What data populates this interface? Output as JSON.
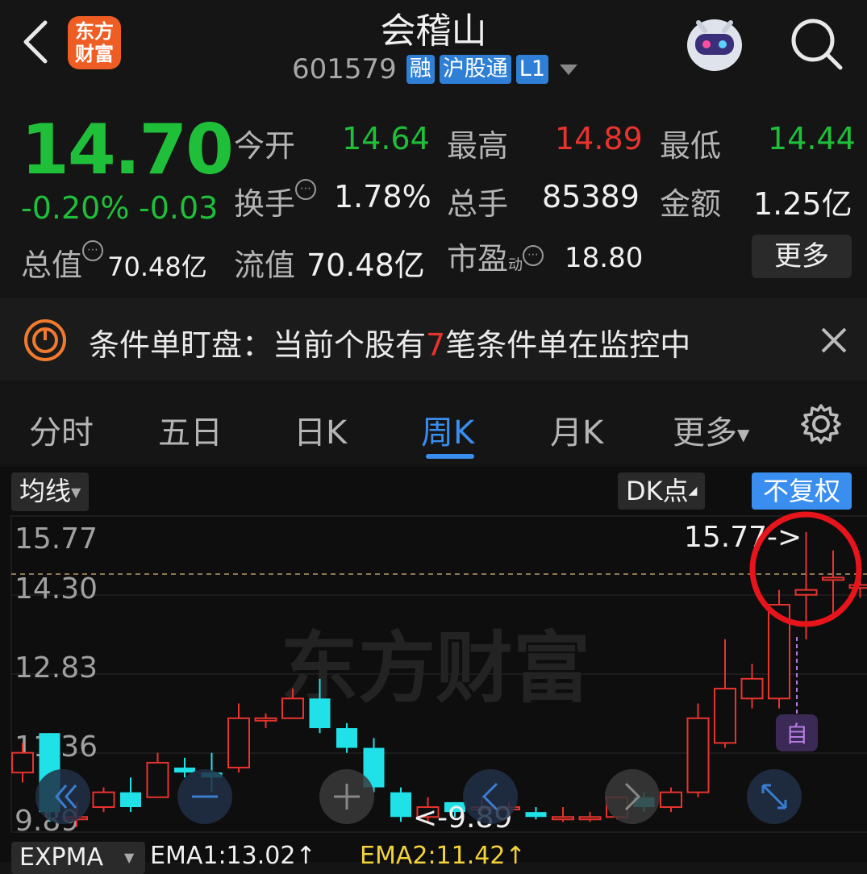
{
  "header": {
    "back_label": "back",
    "logo_line1": "东方",
    "logo_line2": "财富",
    "title": "会稽山",
    "stock_code": "601579",
    "tags": [
      "融",
      "沪股通",
      "L1"
    ]
  },
  "quote": {
    "price": "14.70",
    "change_pct": "-0.20%",
    "change_abs": "-0.03",
    "total_value_label": "总值",
    "total_value": "70.48亿",
    "open_label": "今开",
    "open": "14.64",
    "high_label": "最高",
    "high": "14.89",
    "low_label": "最低",
    "low": "14.44",
    "turnover_label": "换手",
    "turnover": "1.78%",
    "volume_label": "总手",
    "volume": "85389",
    "amount_label": "金额",
    "amount": "1.25亿",
    "float_value_label": "流值",
    "float_value": "70.48亿",
    "pe_label": "市盈",
    "pe_sup": "动",
    "pe": "18.80",
    "more_label": "更多"
  },
  "notice": {
    "prefix": "条件单盯盘：当前个股有",
    "count": "7",
    "suffix": "笔条件单在监控中"
  },
  "tabs": [
    {
      "label": "分时",
      "active": false
    },
    {
      "label": "五日",
      "active": false
    },
    {
      "label": "日K",
      "active": false
    },
    {
      "label": "周K",
      "active": true
    },
    {
      "label": "月K",
      "active": false
    },
    {
      "label": "更多",
      "active": false
    }
  ],
  "chart_toolbar": {
    "ma_label": "均线",
    "dk_label": "DK点",
    "adjust_label": "不复权"
  },
  "chart_data": {
    "type": "candlestick",
    "y_ticks": [
      "15.77",
      "14.30",
      "12.83",
      "11.36",
      "9.89"
    ],
    "ylim": [
      9.89,
      15.77
    ],
    "max_marker": "15.77->",
    "min_marker": "<-9.89",
    "watermark": "东方财富",
    "self_select_badge": "自",
    "candles": [
      {
        "o": 10.9,
        "c": 11.3,
        "h": 11.5,
        "l": 10.7
      },
      {
        "o": 11.7,
        "c": 10.1,
        "h": 11.7,
        "l": 9.9
      },
      {
        "o": 10.0,
        "c": 10.0,
        "h": 10.3,
        "l": 9.8
      },
      {
        "o": 10.2,
        "c": 10.5,
        "h": 10.6,
        "l": 10.1
      },
      {
        "o": 10.5,
        "c": 10.2,
        "h": 10.8,
        "l": 10.1
      },
      {
        "o": 10.4,
        "c": 11.1,
        "h": 11.3,
        "l": 10.4
      },
      {
        "o": 11.0,
        "c": 10.9,
        "h": 11.2,
        "l": 10.8
      },
      {
        "o": 10.9,
        "c": 10.8,
        "h": 11.3,
        "l": 10.5
      },
      {
        "o": 11.0,
        "c": 12.0,
        "h": 12.3,
        "l": 10.9
      },
      {
        "o": 12.0,
        "c": 12.0,
        "h": 12.1,
        "l": 11.8
      },
      {
        "o": 12.0,
        "c": 12.4,
        "h": 12.6,
        "l": 12.0
      },
      {
        "o": 12.4,
        "c": 11.8,
        "h": 12.8,
        "l": 11.7
      },
      {
        "o": 11.8,
        "c": 11.4,
        "h": 11.9,
        "l": 11.3
      },
      {
        "o": 11.4,
        "c": 10.6,
        "h": 11.6,
        "l": 10.5
      },
      {
        "o": 10.5,
        "c": 10.0,
        "h": 10.6,
        "l": 9.9
      },
      {
        "o": 10.0,
        "c": 10.2,
        "h": 10.4,
        "l": 9.89
      },
      {
        "o": 10.3,
        "c": 10.1,
        "h": 10.3,
        "l": 10.0
      },
      {
        "o": 10.2,
        "c": 10.2,
        "h": 10.4,
        "l": 10.1
      },
      {
        "o": 10.2,
        "c": 10.2,
        "h": 10.3,
        "l": 10.1
      },
      {
        "o": 10.1,
        "c": 10.0,
        "h": 10.2,
        "l": 9.95
      },
      {
        "o": 10.0,
        "c": 10.0,
        "h": 10.2,
        "l": 9.9
      },
      {
        "o": 10.0,
        "c": 10.0,
        "h": 10.1,
        "l": 9.9
      },
      {
        "o": 10.0,
        "c": 10.4,
        "h": 10.4,
        "l": 9.95
      },
      {
        "o": 10.4,
        "c": 10.2,
        "h": 10.5,
        "l": 10.1
      },
      {
        "o": 10.2,
        "c": 10.5,
        "h": 10.6,
        "l": 10.1
      },
      {
        "o": 10.5,
        "c": 12.0,
        "h": 12.3,
        "l": 10.4
      },
      {
        "o": 11.5,
        "c": 12.6,
        "h": 13.6,
        "l": 11.4
      },
      {
        "o": 12.4,
        "c": 12.8,
        "h": 13.1,
        "l": 12.2
      },
      {
        "o": 12.4,
        "c": 14.3,
        "h": 14.6,
        "l": 12.2
      },
      {
        "o": 14.5,
        "c": 14.6,
        "h": 15.77,
        "l": 13.6
      },
      {
        "o": 14.8,
        "c": 14.85,
        "h": 15.4,
        "l": 14.0
      },
      {
        "o": 14.64,
        "c": 14.7,
        "h": 14.89,
        "l": 14.44
      }
    ],
    "colors": {
      "up": "#e8332e",
      "down": "#20e0e8"
    }
  },
  "indicator_bar": {
    "name": "EXPMA",
    "ema1": "EMA1:13.02↑",
    "ema2": "EMA2:11.42↑"
  }
}
